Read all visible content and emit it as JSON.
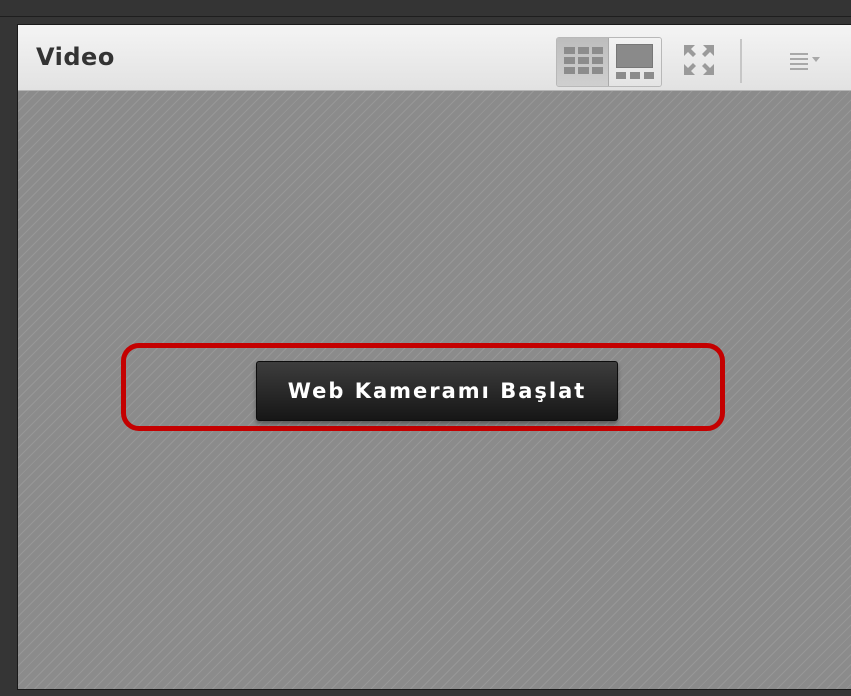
{
  "pod": {
    "title": "Video"
  },
  "actions": {
    "start_webcam_label": "Web Kameramı Başlat"
  },
  "icons": {
    "layout_grid": "grid-layout-icon",
    "layout_single": "single-layout-icon",
    "fullscreen": "fullscreen-icon",
    "menu": "pod-menu-icon"
  },
  "colors": {
    "highlight": "#c40000",
    "button_bg": "#1e1e1e",
    "body_bg": "#8b8b8b"
  }
}
